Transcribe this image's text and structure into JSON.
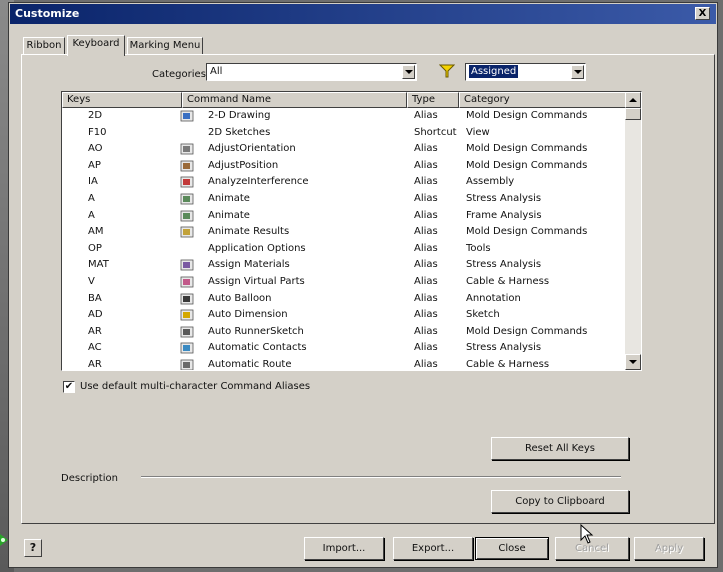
{
  "window": {
    "title": "Customize",
    "close_symbol": "X"
  },
  "tabs": [
    {
      "label": "Ribbon",
      "active": false
    },
    {
      "label": "Keyboard",
      "active": true
    },
    {
      "label": "Marking Menu",
      "active": false
    }
  ],
  "categories": {
    "label": "Categories",
    "selected": "All"
  },
  "filter": {
    "icon": "filter-icon",
    "selected": "Assigned"
  },
  "table": {
    "columns": [
      "Keys",
      "Command Name",
      "Type",
      "Category"
    ],
    "rows": [
      {
        "keys": "2D",
        "command": "2-D Drawing",
        "type": "Alias",
        "category": "Mold Design Commands",
        "icon": "drawing-icon"
      },
      {
        "keys": "F10",
        "command": "2D Sketches",
        "type": "Shortcut",
        "category": "View",
        "icon": ""
      },
      {
        "keys": "AO",
        "command": "AdjustOrientation",
        "type": "Alias",
        "category": "Mold Design Commands",
        "icon": "orientation-icon"
      },
      {
        "keys": "AP",
        "command": "AdjustPosition",
        "type": "Alias",
        "category": "Mold Design Commands",
        "icon": "position-icon"
      },
      {
        "keys": "IA",
        "command": "AnalyzeInterference",
        "type": "Alias",
        "category": "Assembly",
        "icon": "interference-icon"
      },
      {
        "keys": "A",
        "command": "Animate",
        "type": "Alias",
        "category": "Stress Analysis",
        "icon": "animate-icon"
      },
      {
        "keys": "A",
        "command": "Animate",
        "type": "Alias",
        "category": "Frame Analysis",
        "icon": "animate-icon"
      },
      {
        "keys": "AM",
        "command": "Animate Results",
        "type": "Alias",
        "category": "Mold Design Commands",
        "icon": "animate-results-icon"
      },
      {
        "keys": "OP",
        "command": "Application Options",
        "type": "Alias",
        "category": "Tools",
        "icon": ""
      },
      {
        "keys": "MAT",
        "command": "Assign Materials",
        "type": "Alias",
        "category": "Stress Analysis",
        "icon": "materials-icon"
      },
      {
        "keys": "V",
        "command": "Assign Virtual Parts",
        "type": "Alias",
        "category": "Cable & Harness",
        "icon": "virtual-parts-icon"
      },
      {
        "keys": "BA",
        "command": "Auto Balloon",
        "type": "Alias",
        "category": "Annotation",
        "icon": "balloon-icon"
      },
      {
        "keys": "AD",
        "command": "Auto Dimension",
        "type": "Alias",
        "category": "Sketch",
        "icon": "dimension-icon"
      },
      {
        "keys": "AR",
        "command": "Auto RunnerSketch",
        "type": "Alias",
        "category": "Mold Design Commands",
        "icon": "runner-sketch-icon"
      },
      {
        "keys": "AC",
        "command": "Automatic Contacts",
        "type": "Alias",
        "category": "Stress Analysis",
        "icon": "contacts-icon"
      },
      {
        "keys": "AR",
        "command": "Automatic Route",
        "type": "Alias",
        "category": "Cable & Harness",
        "icon": "route-icon"
      }
    ]
  },
  "options": {
    "use_default_aliases_label": "Use default multi-character Command Aliases",
    "use_default_aliases_checked": true,
    "check_mark": "✔"
  },
  "buttons": {
    "reset_all_keys": "Reset All Keys",
    "copy_to_clipboard": "Copy to Clipboard",
    "import": "Import...",
    "export": "Export...",
    "close": "Close",
    "cancel": "Cancel",
    "apply": "Apply",
    "help": "?"
  },
  "description": {
    "label": "Description"
  }
}
